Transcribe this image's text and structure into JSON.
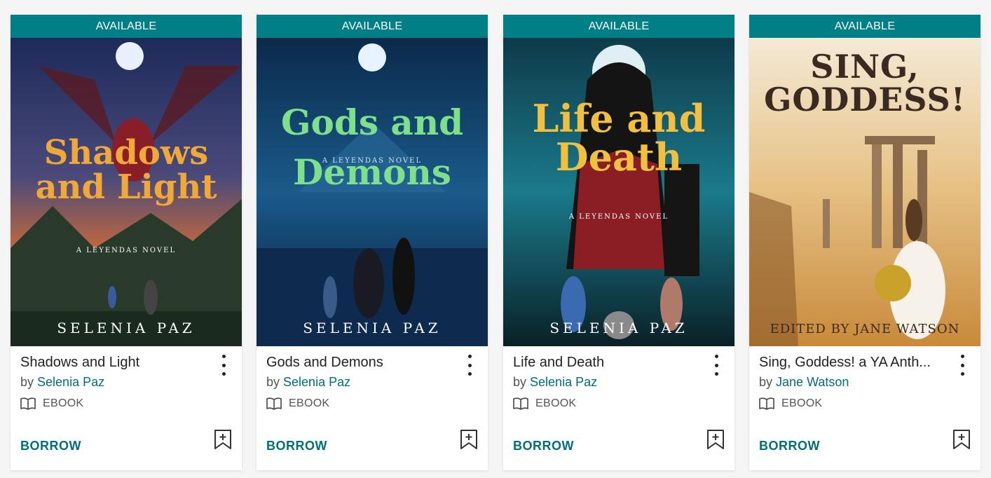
{
  "books": [
    {
      "status": "AVAILABLE",
      "title": "Shadows and Light",
      "by": "by",
      "author": "Selenia Paz",
      "format": "EBOOK",
      "action": "BORROW",
      "cover_title_line1": "Shadows",
      "cover_title_line2": "and Light",
      "cover_series": "A LEYENDAS NOVEL",
      "cover_author": "SELENIA PAZ"
    },
    {
      "status": "AVAILABLE",
      "title": "Gods and Demons",
      "by": "by",
      "author": "Selenia Paz",
      "format": "EBOOK",
      "action": "BORROW",
      "cover_title_line1": "Gods and",
      "cover_title_line2": "Demons",
      "cover_series": "A LEYENDAS NOVEL",
      "cover_author": "SELENIA PAZ"
    },
    {
      "status": "AVAILABLE",
      "title": "Life and Death",
      "by": "by",
      "author": "Selenia Paz",
      "format": "EBOOK",
      "action": "BORROW",
      "cover_title_line1": "Life and",
      "cover_title_line2": "Death",
      "cover_series": "A LEYENDAS NOVEL",
      "cover_author": "SELENIA PAZ"
    },
    {
      "status": "AVAILABLE",
      "title": "Sing, Goddess! a YA Anth...",
      "by": "by",
      "author": "Jane Watson",
      "format": "EBOOK",
      "action": "BORROW",
      "cover_title_line1": "SING,",
      "cover_title_line2": "GODDESS!",
      "cover_edited": "EDITED BY JANE WATSON"
    }
  ],
  "colors": {
    "banner": "#007f87",
    "link": "#00707a"
  },
  "icons": {
    "format": "open-book-icon",
    "menu": "more-vertical-icon",
    "wishlist": "bookmark-plus-icon"
  }
}
